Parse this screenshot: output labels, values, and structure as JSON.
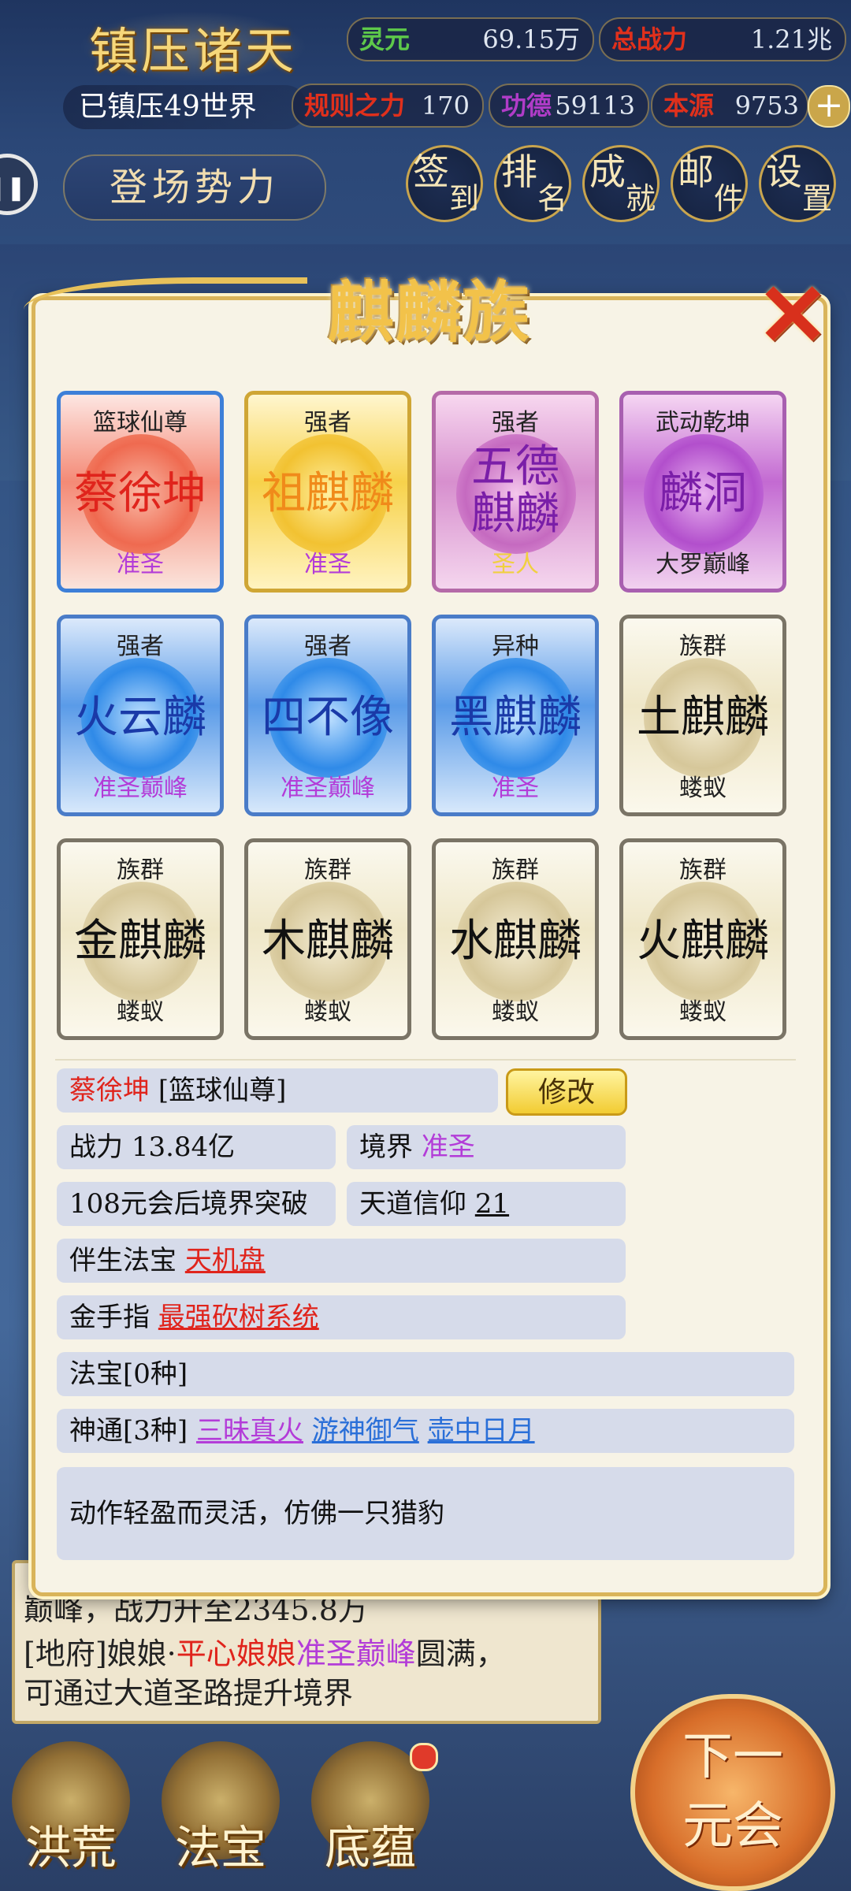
{
  "header": {
    "title": "镇压诸天",
    "suppressed_worlds": "已镇压49世界",
    "stats": [
      {
        "label": "灵元",
        "value": "69.15万",
        "color": "#5ec94a"
      },
      {
        "label": "总战力",
        "value": "1.21兆",
        "color": "#e0301c"
      },
      {
        "label": "规则之力",
        "value": "170",
        "color": "#e0301c"
      },
      {
        "label": "功德",
        "value": "59113",
        "color": "#b03cc8"
      },
      {
        "label": "本源",
        "value": "9753",
        "color": "#e0301c"
      }
    ],
    "faction_button": "登场势力",
    "buttons": [
      {
        "a": "签",
        "b": "到"
      },
      {
        "a": "排",
        "b": "名"
      },
      {
        "a": "成",
        "b": "就"
      },
      {
        "a": "邮",
        "b": "件"
      },
      {
        "a": "设",
        "b": "置"
      }
    ]
  },
  "modal": {
    "title": "麒麟族",
    "close": "✕",
    "cards": [
      {
        "rank": "篮球仙尊",
        "name": "蔡徐坤",
        "realm": "准圣",
        "style": "c-red",
        "name_color": "#e0241c",
        "realm_color": "#b33cd8"
      },
      {
        "rank": "强者",
        "name": "祖麒麟",
        "realm": "准圣",
        "style": "c-gold",
        "name_color": "#f08a1a",
        "realm_color": "#b33cd8"
      },
      {
        "rank": "强者",
        "name": "五德麒麟",
        "realm": "圣人",
        "style": "c-pink",
        "name_color": "#7a1ea8",
        "realm_color": "#f0d040"
      },
      {
        "rank": "武动乾坤",
        "name": "麟洞",
        "realm": "大罗巅峰",
        "style": "c-purple",
        "name_color": "#7a1ea8",
        "realm_color": "#222"
      },
      {
        "rank": "强者",
        "name": "火云麟",
        "realm": "准圣巅峰",
        "style": "c-blue",
        "name_color": "#1a3aa8",
        "realm_color": "#b33cd8"
      },
      {
        "rank": "强者",
        "name": "四不像",
        "realm": "准圣巅峰",
        "style": "c-blue",
        "name_color": "#1a3aa8",
        "realm_color": "#b33cd8"
      },
      {
        "rank": "异种",
        "name": "黑麒麟",
        "realm": "准圣",
        "style": "c-blue",
        "name_color": "#1a3aa8",
        "realm_color": "#b33cd8"
      },
      {
        "rank": "族群",
        "name": "土麒麟",
        "realm": "蝼蚁",
        "style": "c-white",
        "name_color": "#111",
        "realm_color": "#222"
      },
      {
        "rank": "族群",
        "name": "金麒麟",
        "realm": "蝼蚁",
        "style": "c-white",
        "name_color": "#111",
        "realm_color": "#222"
      },
      {
        "rank": "族群",
        "name": "木麒麟",
        "realm": "蝼蚁",
        "style": "c-white",
        "name_color": "#111",
        "realm_color": "#222"
      },
      {
        "rank": "族群",
        "name": "水麒麟",
        "realm": "蝼蚁",
        "style": "c-white",
        "name_color": "#111",
        "realm_color": "#222"
      },
      {
        "rank": "族群",
        "name": "火麒麟",
        "realm": "蝼蚁",
        "style": "c-white",
        "name_color": "#111",
        "realm_color": "#222"
      }
    ],
    "detail": {
      "name": "蔡徐坤",
      "title": "[篮球仙尊]",
      "edit_button": "修改",
      "power_label": "战力",
      "power_value": "13.84亿",
      "realm_label": "境界",
      "realm_value": "准圣",
      "breakthrough": "108元会后境界突破",
      "faith_label": "天道信仰",
      "faith_value": "21",
      "treasure_label": "伴生法宝",
      "treasure_value": "天机盘",
      "cheat_label": "金手指",
      "cheat_value": "最强砍树系统",
      "artifacts": "法宝[0种]",
      "skills_label": "神通[3种]",
      "skills": [
        "三昧真火",
        "游神御气",
        "壶中日月"
      ],
      "description": "动作轻盈而灵活，仿佛一只猎豹"
    }
  },
  "background": {
    "log_line1": "巅峰，战力升至2345.8万",
    "log_line2_prefix": "[地府]娘娘·",
    "log_line2_name": "平心娘娘",
    "log_line2_realm": "准圣巅峰",
    "log_line2_suffix": "圆满，",
    "log_line3": "可通过大道圣路提升境界"
  },
  "bottom_nav": [
    "洪荒",
    "法宝",
    "底蕴"
  ],
  "next_button": {
    "line1": "下一",
    "line2": "元会"
  }
}
